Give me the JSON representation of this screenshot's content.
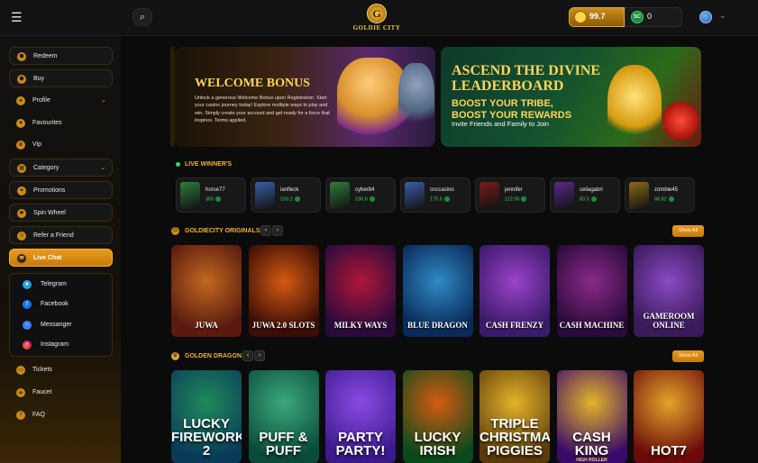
{
  "header": {
    "menu_icon": "menu-icon",
    "search_icon": "search-icon",
    "logo_letter": "G",
    "logo_text": "GOLDIE CITY",
    "gc_balance": "99.7",
    "sc_label": "SC",
    "sc_balance": "0",
    "caret": "⌄"
  },
  "sidebar": {
    "redeem": "Redeem",
    "buy": "Buy",
    "profile": "Profile",
    "favourites": "Favourites",
    "vip": "Vip",
    "category": "Category",
    "promotions": "Promotions",
    "spin_wheel": "Spin Wheel",
    "refer": "Refer a Friend",
    "live_chat": "Live Chat",
    "telegram": "Telegram",
    "facebook": "Facebook",
    "messanger": "Messanger",
    "instagram": "Instagram",
    "tickets": "Tickets",
    "faucet": "Faucet",
    "faq": "FAQ"
  },
  "banners": {
    "welcome_title": "WELCOME BONUS",
    "welcome_text": "Unlock a generous Welcome Bonus upon Registration. Start your casino journey today! Explore multiple ways to play and win. Simply create your account and get ready for a force that inspires. Terms applied.",
    "leader_line1": "ASCEND THE DIVINE",
    "leader_line2": "LEADERBOARD",
    "leader_sub1": "BOOST YOUR TRIBE,",
    "leader_sub2": "BOOST YOUR REWARDS",
    "leader_invite": "Invite Friends and Family to Join"
  },
  "live_winners": {
    "title": "LIVE WINNER'S",
    "items": [
      {
        "name": "horse77",
        "amount": "355",
        "color": "#2f7c3a"
      },
      {
        "name": "ianfleck",
        "amount": "233.2",
        "color": "#3a5fa8"
      },
      {
        "name": "cyber84",
        "amount": "190.6",
        "color": "#2f7c3a"
      },
      {
        "name": "cnccasino",
        "amount": "175.5",
        "color": "#3a5fa8"
      },
      {
        "name": "jennifer",
        "amount": "112.06",
        "color": "#7a1a1a"
      },
      {
        "name": "celiagabri",
        "amount": "83.5",
        "color": "#5a2a8a"
      },
      {
        "name": "zombie45",
        "amount": "68.82",
        "color": "#8a6a1a"
      }
    ]
  },
  "originals": {
    "title": "GOLDIECITY ORIGINALS",
    "show_all": "Show All",
    "prev": "‹",
    "next": "›",
    "games": [
      {
        "title": "JUWA",
        "c1": "#5a1a10",
        "c2": "#c2691e"
      },
      {
        "title": "JUWA 2.0 SLOTS",
        "c1": "#3a0d05",
        "c2": "#d45a12"
      },
      {
        "title": "MILKY WAYS",
        "c1": "#2a0a3a",
        "c2": "#b0173a"
      },
      {
        "title": "BLUE DRAGON",
        "c1": "#0a2a5a",
        "c2": "#2f8bc4"
      },
      {
        "title": "CASH FRENZY",
        "c1": "#3a1a6a",
        "c2": "#9b42c9"
      },
      {
        "title": "CASH MACHINE",
        "c1": "#2a0a3a",
        "c2": "#8a2a8a"
      },
      {
        "title": "GAMEROOM ONLINE",
        "c1": "#3a1a5a",
        "c2": "#8a4ac4"
      }
    ]
  },
  "golden_dragon": {
    "title": "GOLDEN DRAGON",
    "show_all": "Show All",
    "prev": "‹",
    "next": "›",
    "games": [
      {
        "title": "LUCKY FIREWORKS 2",
        "sub": "",
        "c1": "#0a3a5a",
        "c2": "#1f8a5a"
      },
      {
        "title": "PUFF & PUFF",
        "sub": "",
        "c1": "#0a4a3a",
        "c2": "#3aa87a"
      },
      {
        "title": "PARTY PARTY!",
        "sub": "",
        "c1": "#3a1a8a",
        "c2": "#8a4ae4"
      },
      {
        "title": "LUCKY IRISH",
        "sub": "",
        "c1": "#0a4a1a",
        "c2": "#d45a12"
      },
      {
        "title": "TRIPLE CHRISTMAS PIGGIES",
        "sub": "",
        "c1": "#5a3a0a",
        "c2": "#e4b42a"
      },
      {
        "title": "CASH KING",
        "sub": "HIGH ROLLER",
        "c1": "#3a0a6a",
        "c2": "#e4b42a"
      },
      {
        "title": "HOT7",
        "sub": "",
        "c1": "#6a0a0a",
        "c2": "#e4a42a"
      }
    ]
  }
}
